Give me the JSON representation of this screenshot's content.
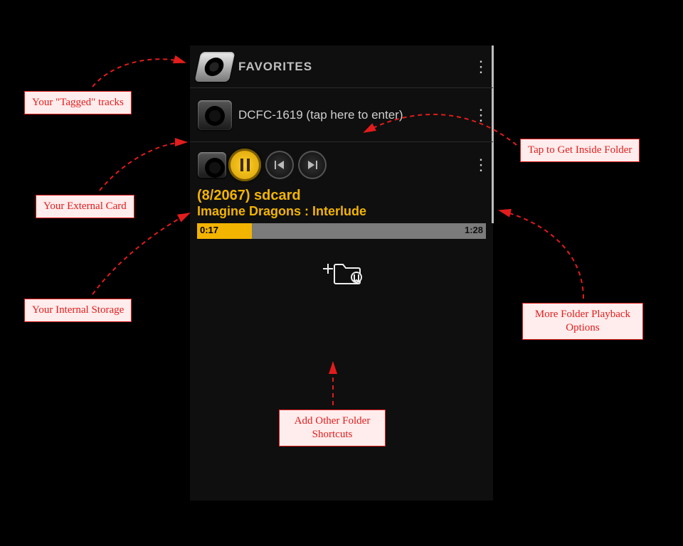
{
  "favorites": {
    "label": "FAVORITES"
  },
  "folder": {
    "label": "DCFC-1619 (tap here to enter)"
  },
  "nowplaying": {
    "counter": "(8/2067)  sdcard",
    "title": "Imagine Dragons : Interlude",
    "elapsed": "0:17",
    "total": "1:28",
    "progress_pct": 19
  },
  "callouts": {
    "tagged": "Your \"Tagged\" tracks",
    "external": "Your External Card",
    "internal": "Your Internal Storage",
    "enter": "Tap to Get Inside Folder",
    "more": "More Folder Playback Options",
    "addshort": "Add Other Folder Shortcuts"
  }
}
